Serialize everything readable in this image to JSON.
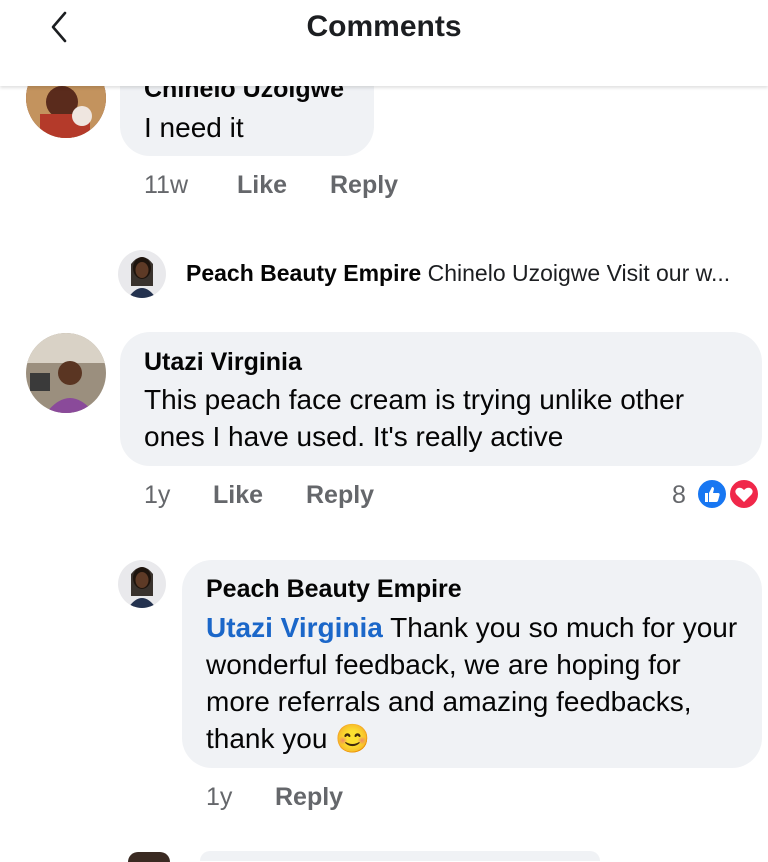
{
  "header": {
    "title": "Comments",
    "back_icon": "chevron-left-icon"
  },
  "comments": [
    {
      "author": "Chinelo Uzoigwe",
      "text": "I need it",
      "time": "11w",
      "like": "Like",
      "reply": "Reply"
    },
    {
      "collapsed_reply": {
        "author": "Peach Beauty Empire",
        "preview": "Chinelo Uzoigwe Visit our w..."
      }
    },
    {
      "author": "Utazi Virginia",
      "text": "This peach face cream is trying unlike other ones I have used. It's really active",
      "time": "1y",
      "like": "Like",
      "reply": "Reply",
      "reactions": {
        "count": "8",
        "icons": [
          "like-reaction-icon",
          "love-reaction-icon"
        ]
      }
    },
    {
      "author": "Peach Beauty Empire",
      "mention": "Utazi Virginia",
      "text": "Thank you so much for your wonderful feedback, we are hoping for more referrals and amazing feedbacks, thank you",
      "emoji": "😊",
      "time": "1y",
      "reply": "Reply"
    }
  ],
  "colors": {
    "bubble": "#f0f2f5",
    "mention": "#1b67c9",
    "like_blue": "#1877f2",
    "love_red": "#f0284a",
    "meta_gray": "#65676b"
  }
}
